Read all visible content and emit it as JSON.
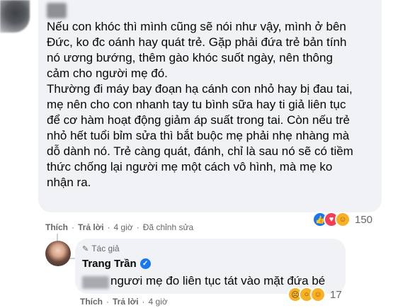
{
  "comment": {
    "lines": [
      "Nếu con khóc thì mình cũng sẽ nói như vậy, mình ở bên",
      "Đức, ko đc oánh hay quát trẻ. Gặp phải đứa trẻ bản tính",
      "nó ương bướng, thêm gào khóc suốt ngày, nên thông",
      "cảm cho người mẹ đó.",
      "Thường đi máy bay đoạn hạ cánh con nhỏ hay bị đau tai,",
      "mẹ nên cho con nhanh tay tu bình sữa hay ti giả liên tục",
      "để cơ hàm hoạt động giảm áp suất trong tai. Còn nếu trẻ",
      "nhỏ hết tuổi bỉm sửa thì bắt buộc mẹ phải nhẹ nhàng mà",
      "dỗ dành nó. Trẻ càng quát, đánh, chỉ là sau nó sẽ có tiềm",
      "thức chống lại người mẹ một cách vô hình, mà mẹ ko",
      "nhận ra."
    ],
    "reaction_count": "150",
    "reaction_icons": [
      "like-icon",
      "love-icon",
      "care-icon"
    ],
    "actions": {
      "like": "Thích",
      "reply": "Trả lời",
      "time": "4 giờ",
      "edited": "Đã chỉnh sửa"
    }
  },
  "reply": {
    "badge": "Tác giả",
    "author": "Trang Trần",
    "text": "ngươi mẹ đo liên tục tát vào mặt đứa bé",
    "reaction_count": "17",
    "reaction_icons": [
      "sad-icon",
      "wow-icon",
      "care-icon"
    ],
    "actions": {
      "like": "Thích",
      "reply": "Trả lời",
      "time": "4 giờ"
    }
  },
  "colors": {
    "bubble": "#f0f2f5",
    "meta": "#65676b",
    "accent": "#1877f2"
  }
}
